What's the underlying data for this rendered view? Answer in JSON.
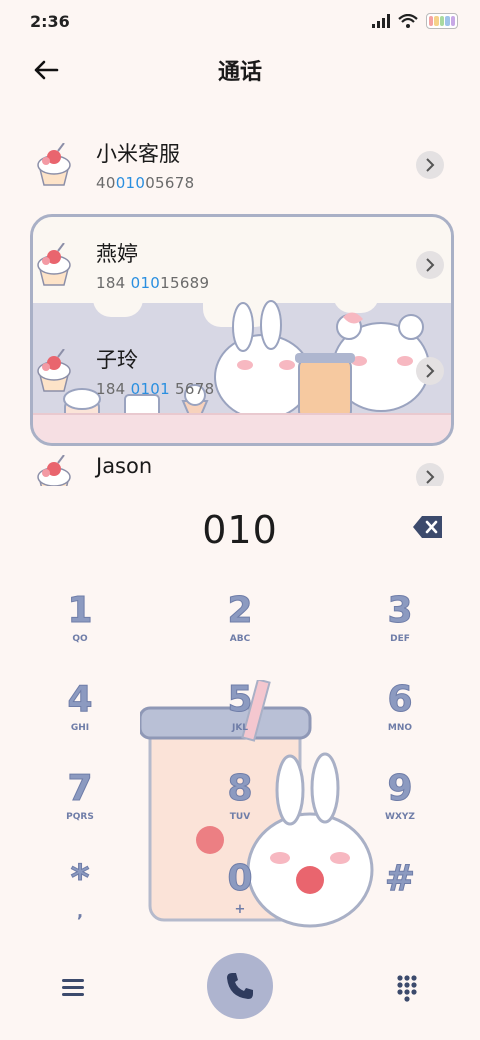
{
  "status_bar": {
    "time": "2:36",
    "battery_colors": [
      "#f4a3a3",
      "#f6d28a",
      "#a9d9a0",
      "#9fc3ea",
      "#c8a9e6"
    ]
  },
  "header": {
    "title": "通话",
    "back_icon": "arrow-left-icon"
  },
  "contacts": [
    {
      "name": "小米客服",
      "number_pre": "40",
      "number_hl": "010",
      "number_post": "05678"
    },
    {
      "name": "燕婷",
      "number_pre": "184 ",
      "number_hl": "010",
      "number_post": "15689"
    },
    {
      "name": "子玲",
      "number_pre": "184 ",
      "number_hl": "0101",
      "number_post": " 5678"
    },
    {
      "name": "Jason",
      "number_pre": "",
      "number_hl": "",
      "number_post": ""
    }
  ],
  "dial": {
    "input": "010",
    "backspace_icon": "backspace-icon"
  },
  "keypad": [
    {
      "digit": "1",
      "letters": "QO"
    },
    {
      "digit": "2",
      "letters": "ABC"
    },
    {
      "digit": "3",
      "letters": "DEF"
    },
    {
      "digit": "4",
      "letters": "GHI"
    },
    {
      "digit": "5",
      "letters": "JKL"
    },
    {
      "digit": "6",
      "letters": "MNO"
    },
    {
      "digit": "7",
      "letters": "PQRS"
    },
    {
      "digit": "8",
      "letters": "TUV"
    },
    {
      "digit": "9",
      "letters": "WXYZ"
    },
    {
      "digit": "*",
      "letters": ","
    },
    {
      "digit": "0",
      "letters": "+"
    },
    {
      "digit": "#",
      "letters": ""
    }
  ],
  "bottom_bar": {
    "menu_icon": "menu-icon",
    "call_icon": "phone-icon",
    "dialpad_icon": "dialpad-icon"
  },
  "colors": {
    "highlight": "#2a8fe0",
    "keypad_digit": "#8c9ac0",
    "call_button": "#aeb4cf"
  }
}
